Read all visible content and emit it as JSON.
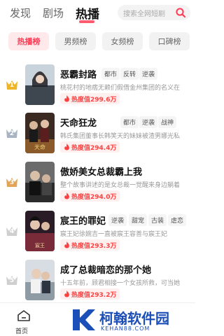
{
  "top_tabs": [
    "发现",
    "剧场",
    "热播"
  ],
  "search": {
    "placeholder": "搜索全网短剧"
  },
  "chips": [
    "热播榜",
    "男频榜",
    "女频榜",
    "口碑榜"
  ],
  "dramas": [
    {
      "rank": "1",
      "title": "恶霸封路",
      "tags": [
        "都市",
        "反转",
        "逆袭"
      ],
      "desc": "桃花村的地痞无赖们假借金州集团的名义在",
      "heat": "热度值299.6万"
    },
    {
      "rank": "2",
      "title": "天命狂龙",
      "tags": [
        "都市",
        "逆袭",
        "战神"
      ],
      "desc": "韩氏集团董事长韩笑天的妹妹被渣男娜光私",
      "heat": "热度值294.4万"
    },
    {
      "rank": "3",
      "title": "傲娇美女总裁霸上我",
      "tags": [],
      "desc": "整个故事讲述的是女总裁一觉醒来身边躺着",
      "heat": "热度值294.0万"
    },
    {
      "rank": "4",
      "title": "宸王的罪妃",
      "tags": [
        "逆袭",
        "甜宠",
        "古装",
        "虐恋"
      ],
      "desc": "宸王妃徐婉吉一直被宸王容善与宸王妃",
      "heat": "热度值293.3万"
    },
    {
      "rank": "5",
      "title": "成了总裁暗恋的那个她",
      "tags": [],
      "desc": "十五年前，顾君相接一个女孩所救，可当她",
      "heat": "热度值293.2万"
    }
  ],
  "bottom_nav": {
    "home_label": "首页"
  },
  "watermark": {
    "cn": "柯翰软件园",
    "en": "KEHAN88.COM"
  },
  "colors": {
    "accent": "#ff5a6e",
    "heat": "#ff4040",
    "gold": "#f0b427",
    "silver": "#a9b4c2",
    "bronze": "#e3a455",
    "brand_blue": "#1d4fb8"
  }
}
